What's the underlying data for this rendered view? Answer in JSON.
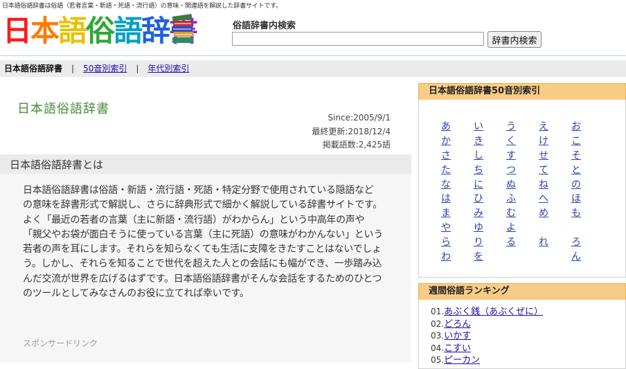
{
  "header": {
    "tagline": "日本語俗語辞書は俗語（若者言葉・新語・死語・流行語）の意味・関連語を解説した辞書サイトです。",
    "logo_text": "日本語俗語辞書",
    "logo_colors": [
      "#ff1a1a",
      "#ff7a00",
      "#e6c200",
      "#2ea832",
      "#00a0c8",
      "#2060e0",
      "#8a2be2"
    ],
    "search_label": "俗語辞書内検索",
    "search_value": "",
    "search_button": "辞書内検索"
  },
  "nav": {
    "home": "日本語俗語辞書",
    "separator": "|",
    "gojuon_link": "50音別索引",
    "era_link": "年代別索引"
  },
  "main": {
    "title": "日本語俗語辞書",
    "since": "Since:2005/9/1",
    "updated": "最終更新:2018/12/4",
    "count": "掲載語数:2,425語",
    "section_title": "日本語俗語辞書とは",
    "intro_p1": "日本語俗語辞書は俗語・新語・流行語・死語・特定分野で使用されている隠語などの意味を辞書形式で解説し、さらに辞典形式で細かく解説している辞書サイトです。",
    "intro_p2": "よく「最近の若者の言葉（主に新語・流行語）がわからん」という中高年の声や「親父やお袋が面白そうに使っている言葉（主に死語）の意味がわかんない」という若者の声を耳にします。それらを知らなくても生活に支障をきたすことはないでしょう。しかし、それらを知ることで世代を超えた人との会話にも幅ができ、一歩踏み込んだ交流が世界を広げるはずです。日本語俗語辞書がそんな会話をするためのひとつのツールとしてみなさんのお役に立てれば幸いです。",
    "sponsor": "スポンサードリンク"
  },
  "sidebar": {
    "index_title": "日本語俗語辞書50音別索引",
    "kana": [
      "あ",
      "い",
      "う",
      "え",
      "お",
      "か",
      "き",
      "く",
      "け",
      "こ",
      "さ",
      "し",
      "す",
      "せ",
      "そ",
      "た",
      "ち",
      "つ",
      "て",
      "と",
      "な",
      "に",
      "ぬ",
      "ね",
      "の",
      "は",
      "ひ",
      "ふ",
      "へ",
      "ほ",
      "ま",
      "み",
      "む",
      "め",
      "も",
      "や",
      "ゆ",
      "よ",
      "",
      "",
      "ら",
      "り",
      "る",
      "れ",
      "ろ",
      "わ",
      "を",
      "",
      "",
      "ん"
    ],
    "ranking_title": "週間俗語ランキング",
    "ranking": [
      {
        "num": "01.",
        "label": "あぶく銭（あぶくぜに）"
      },
      {
        "num": "02.",
        "label": "どろん"
      },
      {
        "num": "03.",
        "label": "いかす"
      },
      {
        "num": "04.",
        "label": "こすい"
      },
      {
        "num": "05.",
        "label": "ピーカン"
      }
    ]
  },
  "colors": {
    "title_green": "#4a8a3a",
    "sidebar_header": "#f7cc87",
    "link": "#1a0dab"
  }
}
